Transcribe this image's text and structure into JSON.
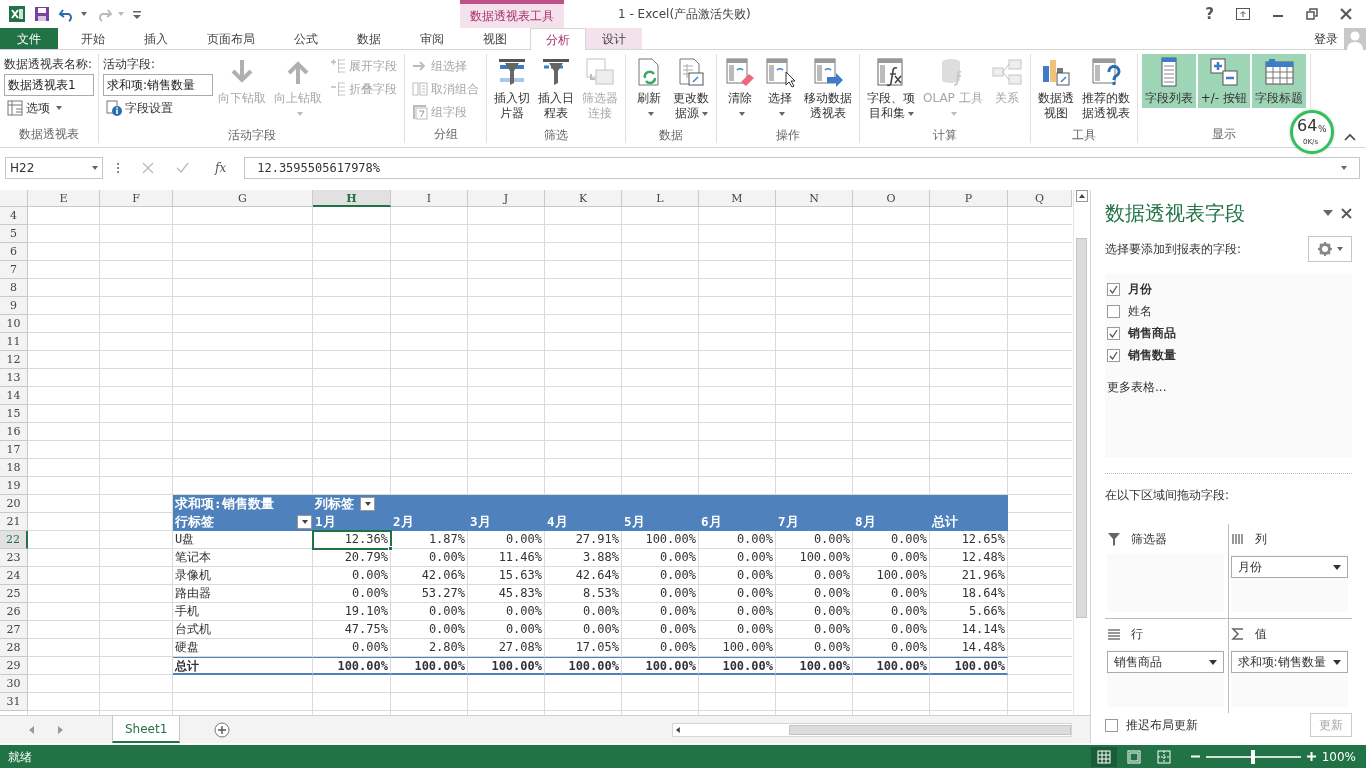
{
  "title_bar": {
    "context_group": "数据透视表工具",
    "title": "1 - Excel(产品激活失败)",
    "help": "?"
  },
  "ribbon_tabs": [
    {
      "label": "文件",
      "kind": "file",
      "selected": false
    },
    {
      "label": "开始",
      "kind": "standard",
      "selected": false
    },
    {
      "label": "插入",
      "kind": "standard",
      "selected": false
    },
    {
      "label": "页面布局",
      "kind": "standard",
      "selected": false
    },
    {
      "label": "公式",
      "kind": "standard",
      "selected": false
    },
    {
      "label": "数据",
      "kind": "standard",
      "selected": false
    },
    {
      "label": "审阅",
      "kind": "standard",
      "selected": false
    },
    {
      "label": "视图",
      "kind": "standard",
      "selected": false
    },
    {
      "label": "分析",
      "kind": "context",
      "selected": true
    },
    {
      "label": "设计",
      "kind": "context",
      "selected": false
    }
  ],
  "account": {
    "label": "登录"
  },
  "ribbon_groups": [
    {
      "label": "数据透视表",
      "items": [
        {
          "kind": "stack",
          "items": [
            {
              "kind": "caption",
              "label": "数据透视表名称:"
            },
            {
              "kind": "field",
              "value": "数据透视表1"
            },
            {
              "kind": "small",
              "label": "选项",
              "disabled": false,
              "dropdown": true
            }
          ]
        }
      ]
    },
    {
      "label": "活动字段",
      "items": [
        {
          "kind": "stack",
          "items": [
            {
              "kind": "caption",
              "label": "活动字段:"
            },
            {
              "kind": "field",
              "value": "求和项:销售数量"
            },
            {
              "kind": "small",
              "label": "字段设置",
              "disabled": false,
              "dropdown": false
            }
          ]
        },
        {
          "kind": "large",
          "label": "向下钻取",
          "disabled": true,
          "dropdown": false
        },
        {
          "kind": "large",
          "label": "向上钻取",
          "disabled": true,
          "dropdown": true
        },
        {
          "kind": "stack",
          "items": [
            {
              "kind": "small",
              "label": "展开字段",
              "disabled": true,
              "dropdown": false
            },
            {
              "kind": "small",
              "label": "折叠字段",
              "disabled": true,
              "dropdown": false
            }
          ]
        }
      ]
    },
    {
      "label": "分组",
      "items": [
        {
          "kind": "stack",
          "items": [
            {
              "kind": "small",
              "label": "组选择",
              "disabled": true,
              "dropdown": false
            },
            {
              "kind": "small",
              "label": "取消组合",
              "disabled": true,
              "dropdown": false
            },
            {
              "kind": "small",
              "label": "组字段",
              "disabled": true,
              "dropdown": false
            }
          ]
        }
      ]
    },
    {
      "label": "筛选",
      "items": [
        {
          "kind": "large",
          "label": "插入切片器",
          "disabled": false,
          "dropdown": false
        },
        {
          "kind": "large",
          "label": "插入日程表",
          "disabled": false,
          "dropdown": false
        },
        {
          "kind": "large",
          "label": "筛选器连接",
          "disabled": true,
          "dropdown": false
        }
      ]
    },
    {
      "label": "数据",
      "items": [
        {
          "kind": "large",
          "label": "刷新",
          "disabled": false,
          "dropdown": true
        },
        {
          "kind": "large",
          "label": "更改数据源",
          "disabled": false,
          "dropdown": true
        }
      ]
    },
    {
      "label": "操作",
      "items": [
        {
          "kind": "large",
          "label": "清除",
          "disabled": false,
          "dropdown": true
        },
        {
          "kind": "large",
          "label": "选择",
          "disabled": false,
          "dropdown": true
        },
        {
          "kind": "large",
          "label": "移动数据透视表",
          "disabled": false,
          "dropdown": false
        }
      ]
    },
    {
      "label": "计算",
      "items": [
        {
          "kind": "large",
          "label": "字段、项目和集",
          "disabled": false,
          "dropdown": true
        },
        {
          "kind": "large",
          "label": "OLAP 工具",
          "disabled": true,
          "dropdown": true
        },
        {
          "kind": "large",
          "label": "关系",
          "disabled": true,
          "dropdown": false
        }
      ]
    },
    {
      "label": "工具",
      "items": [
        {
          "kind": "large",
          "label": "数据透视图",
          "disabled": false,
          "dropdown": false
        },
        {
          "kind": "large",
          "label": "推荐的数据透视表",
          "disabled": false,
          "dropdown": false
        }
      ]
    },
    {
      "label": "显示",
      "items": [
        {
          "kind": "toggle",
          "label": "字段列表",
          "disabled": false,
          "selected": true
        },
        {
          "kind": "toggle",
          "label": "+/- 按钮",
          "disabled": false,
          "selected": true
        },
        {
          "kind": "toggle",
          "label": "字段标题",
          "disabled": false,
          "selected": true
        }
      ]
    }
  ],
  "formula_bar": {
    "name_box": "H22",
    "function_button": "fx",
    "formula": "12.3595505617978%"
  },
  "sheet": {
    "columns": [
      {
        "label": "E",
        "selected": false
      },
      {
        "label": "F",
        "selected": false
      },
      {
        "label": "G",
        "selected": false
      },
      {
        "label": "H",
        "selected": true
      },
      {
        "label": "I",
        "selected": false
      },
      {
        "label": "J",
        "selected": false
      },
      {
        "label": "K",
        "selected": false
      },
      {
        "label": "L",
        "selected": false
      },
      {
        "label": "M",
        "selected": false
      },
      {
        "label": "N",
        "selected": false
      },
      {
        "label": "O",
        "selected": false
      },
      {
        "label": "P",
        "selected": false
      },
      {
        "label": "Q",
        "selected": false
      }
    ],
    "rows": [
      {
        "label": "4",
        "selected": false
      },
      {
        "label": "5",
        "selected": false
      },
      {
        "label": "6",
        "selected": false
      },
      {
        "label": "7",
        "selected": false
      },
      {
        "label": "8",
        "selected": false
      },
      {
        "label": "9",
        "selected": false
      },
      {
        "label": "10",
        "selected": false
      },
      {
        "label": "11",
        "selected": false
      },
      {
        "label": "12",
        "selected": false
      },
      {
        "label": "13",
        "selected": false
      },
      {
        "label": "14",
        "selected": false
      },
      {
        "label": "15",
        "selected": false
      },
      {
        "label": "16",
        "selected": false
      },
      {
        "label": "17",
        "selected": false
      },
      {
        "label": "18",
        "selected": false
      },
      {
        "label": "19",
        "selected": false
      },
      {
        "label": "20",
        "selected": false
      },
      {
        "label": "21",
        "selected": false
      },
      {
        "label": "22",
        "selected": true
      },
      {
        "label": "23",
        "selected": false
      },
      {
        "label": "24",
        "selected": false
      },
      {
        "label": "25",
        "selected": false
      },
      {
        "label": "26",
        "selected": false
      },
      {
        "label": "27",
        "selected": false
      },
      {
        "label": "28",
        "selected": false
      },
      {
        "label": "29",
        "selected": false
      },
      {
        "label": "30",
        "selected": false
      },
      {
        "label": "31",
        "selected": false
      }
    ]
  },
  "pivot": {
    "value_field": "求和项:销售数量",
    "column_label": "列标签",
    "row_label": "行标签",
    "columns": [
      "1月",
      "2月",
      "3月",
      "4月",
      "5月",
      "6月",
      "7月",
      "8月",
      "总计"
    ],
    "rows": [
      {
        "label": "U盘",
        "cells": [
          {
            "text": "12.36%",
            "selected": true
          },
          {
            "text": "1.87%",
            "selected": false
          },
          {
            "text": "0.00%",
            "selected": false
          },
          {
            "text": "27.91%",
            "selected": false
          },
          {
            "text": "100.00%",
            "selected": false
          },
          {
            "text": "0.00%",
            "selected": false
          },
          {
            "text": "0.00%",
            "selected": false
          },
          {
            "text": "0.00%",
            "selected": false
          },
          {
            "text": "12.65%",
            "selected": false
          }
        ]
      },
      {
        "label": "笔记本",
        "cells": [
          {
            "text": "20.79%",
            "selected": false
          },
          {
            "text": "0.00%",
            "selected": false
          },
          {
            "text": "11.46%",
            "selected": false
          },
          {
            "text": "3.88%",
            "selected": false
          },
          {
            "text": "0.00%",
            "selected": false
          },
          {
            "text": "0.00%",
            "selected": false
          },
          {
            "text": "100.00%",
            "selected": false
          },
          {
            "text": "0.00%",
            "selected": false
          },
          {
            "text": "12.48%",
            "selected": false
          }
        ]
      },
      {
        "label": "录像机",
        "cells": [
          {
            "text": "0.00%",
            "selected": false
          },
          {
            "text": "42.06%",
            "selected": false
          },
          {
            "text": "15.63%",
            "selected": false
          },
          {
            "text": "42.64%",
            "selected": false
          },
          {
            "text": "0.00%",
            "selected": false
          },
          {
            "text": "0.00%",
            "selected": false
          },
          {
            "text": "0.00%",
            "selected": false
          },
          {
            "text": "100.00%",
            "selected": false
          },
          {
            "text": "21.96%",
            "selected": false
          }
        ]
      },
      {
        "label": "路由器",
        "cells": [
          {
            "text": "0.00%",
            "selected": false
          },
          {
            "text": "53.27%",
            "selected": false
          },
          {
            "text": "45.83%",
            "selected": false
          },
          {
            "text": "8.53%",
            "selected": false
          },
          {
            "text": "0.00%",
            "selected": false
          },
          {
            "text": "0.00%",
            "selected": false
          },
          {
            "text": "0.00%",
            "selected": false
          },
          {
            "text": "0.00%",
            "selected": false
          },
          {
            "text": "18.64%",
            "selected": false
          }
        ]
      },
      {
        "label": "手机",
        "cells": [
          {
            "text": "19.10%",
            "selected": false
          },
          {
            "text": "0.00%",
            "selected": false
          },
          {
            "text": "0.00%",
            "selected": false
          },
          {
            "text": "0.00%",
            "selected": false
          },
          {
            "text": "0.00%",
            "selected": false
          },
          {
            "text": "0.00%",
            "selected": false
          },
          {
            "text": "0.00%",
            "selected": false
          },
          {
            "text": "0.00%",
            "selected": false
          },
          {
            "text": "5.66%",
            "selected": false
          }
        ]
      },
      {
        "label": "台式机",
        "cells": [
          {
            "text": "47.75%",
            "selected": false
          },
          {
            "text": "0.00%",
            "selected": false
          },
          {
            "text": "0.00%",
            "selected": false
          },
          {
            "text": "0.00%",
            "selected": false
          },
          {
            "text": "0.00%",
            "selected": false
          },
          {
            "text": "0.00%",
            "selected": false
          },
          {
            "text": "0.00%",
            "selected": false
          },
          {
            "text": "0.00%",
            "selected": false
          },
          {
            "text": "14.14%",
            "selected": false
          }
        ]
      },
      {
        "label": "硬盘",
        "cells": [
          {
            "text": "0.00%",
            "selected": false
          },
          {
            "text": "2.80%",
            "selected": false
          },
          {
            "text": "27.08%",
            "selected": false
          },
          {
            "text": "17.05%",
            "selected": false
          },
          {
            "text": "0.00%",
            "selected": false
          },
          {
            "text": "100.00%",
            "selected": false
          },
          {
            "text": "0.00%",
            "selected": false
          },
          {
            "text": "0.00%",
            "selected": false
          },
          {
            "text": "14.48%",
            "selected": false
          }
        ]
      }
    ],
    "total": {
      "label": "总计",
      "cells": [
        {
          "text": "100.00%",
          "selected": false
        },
        {
          "text": "100.00%",
          "selected": false
        },
        {
          "text": "100.00%",
          "selected": false
        },
        {
          "text": "100.00%",
          "selected": false
        },
        {
          "text": "100.00%",
          "selected": false
        },
        {
          "text": "100.00%",
          "selected": false
        },
        {
          "text": "100.00%",
          "selected": false
        },
        {
          "text": "100.00%",
          "selected": false
        },
        {
          "text": "100.00%",
          "selected": false
        }
      ]
    }
  },
  "sheet_tabs": [
    {
      "label": "Sheet1",
      "selected": true
    }
  ],
  "task_pane": {
    "title": "数据透视表字段",
    "instruction": "选择要添加到报表的字段:",
    "fields": [
      {
        "label": "月份",
        "checked": true
      },
      {
        "label": "姓名",
        "checked": false
      },
      {
        "label": "销售商品",
        "checked": true
      },
      {
        "label": "销售数量",
        "checked": true
      }
    ],
    "more_tables": "更多表格...",
    "areas_caption": "在以下区域间拖动字段:",
    "areas": [
      {
        "label": "筛选器"
      },
      {
        "label": "列",
        "items": [
          "月份"
        ]
      },
      {
        "label": "行",
        "items": [
          "销售商品"
        ]
      },
      {
        "label": "值",
        "items": [
          "求和项:销售数量"
        ]
      }
    ],
    "defer_update": {
      "label": "推迟布局更新",
      "checked": false
    },
    "update_button": {
      "label": "更新",
      "disabled": true
    }
  },
  "status_bar": {
    "status": "就绪",
    "view_buttons": [
      {
        "selected": true
      },
      {
        "selected": false
      },
      {
        "selected": false
      }
    ],
    "zoom": {
      "level": 0.5,
      "reading": "100%"
    }
  },
  "speed_widget": {
    "percent": "64",
    "unit": "%",
    "speed": "0K/s"
  }
}
